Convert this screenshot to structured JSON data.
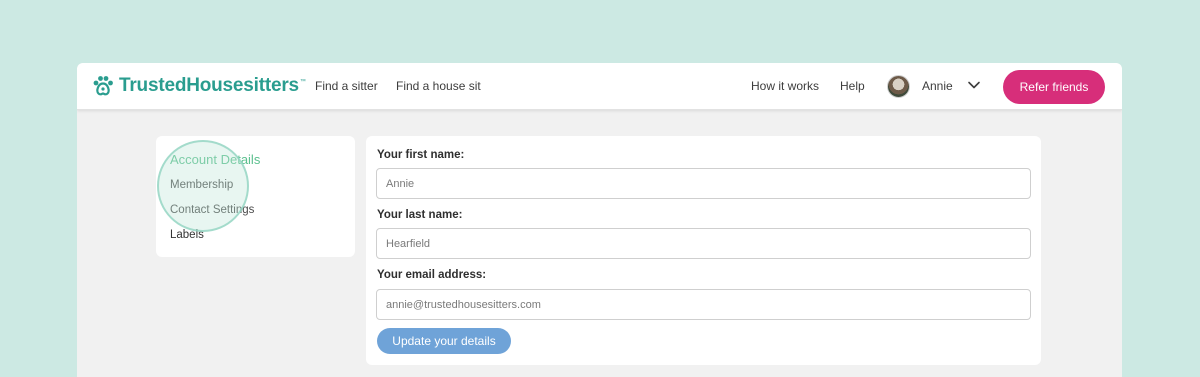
{
  "brand": {
    "name": "TrustedHousesitters",
    "trademark": "™",
    "logo_icon": "paw-icon",
    "color": "#2a9d8f"
  },
  "nav": {
    "left_links": [
      "Find a sitter",
      "Find a house sit"
    ],
    "right_links": [
      "How it works",
      "Help"
    ],
    "user": {
      "name": "Annie",
      "avatar_icon": "avatar-photo",
      "menu_icon": "chevron-down-icon"
    },
    "cta_label": "Refer friends",
    "cta_color": "#d72e7a"
  },
  "sidebar": {
    "items": [
      {
        "label": "Account Details",
        "active": true
      },
      {
        "label": "Membership"
      },
      {
        "label": "Contact Settings"
      },
      {
        "label": "Labels"
      }
    ],
    "active_color": "#5cc08f"
  },
  "form": {
    "fields": [
      {
        "label": "Your first name:",
        "value": "Annie"
      },
      {
        "label": "Your last name:",
        "value": "Hearfield"
      },
      {
        "label": "Your email address:",
        "value": "annie@trustedhousesitters.com"
      }
    ],
    "submit_label": "Update your details",
    "submit_color": "#6fa3d8"
  }
}
